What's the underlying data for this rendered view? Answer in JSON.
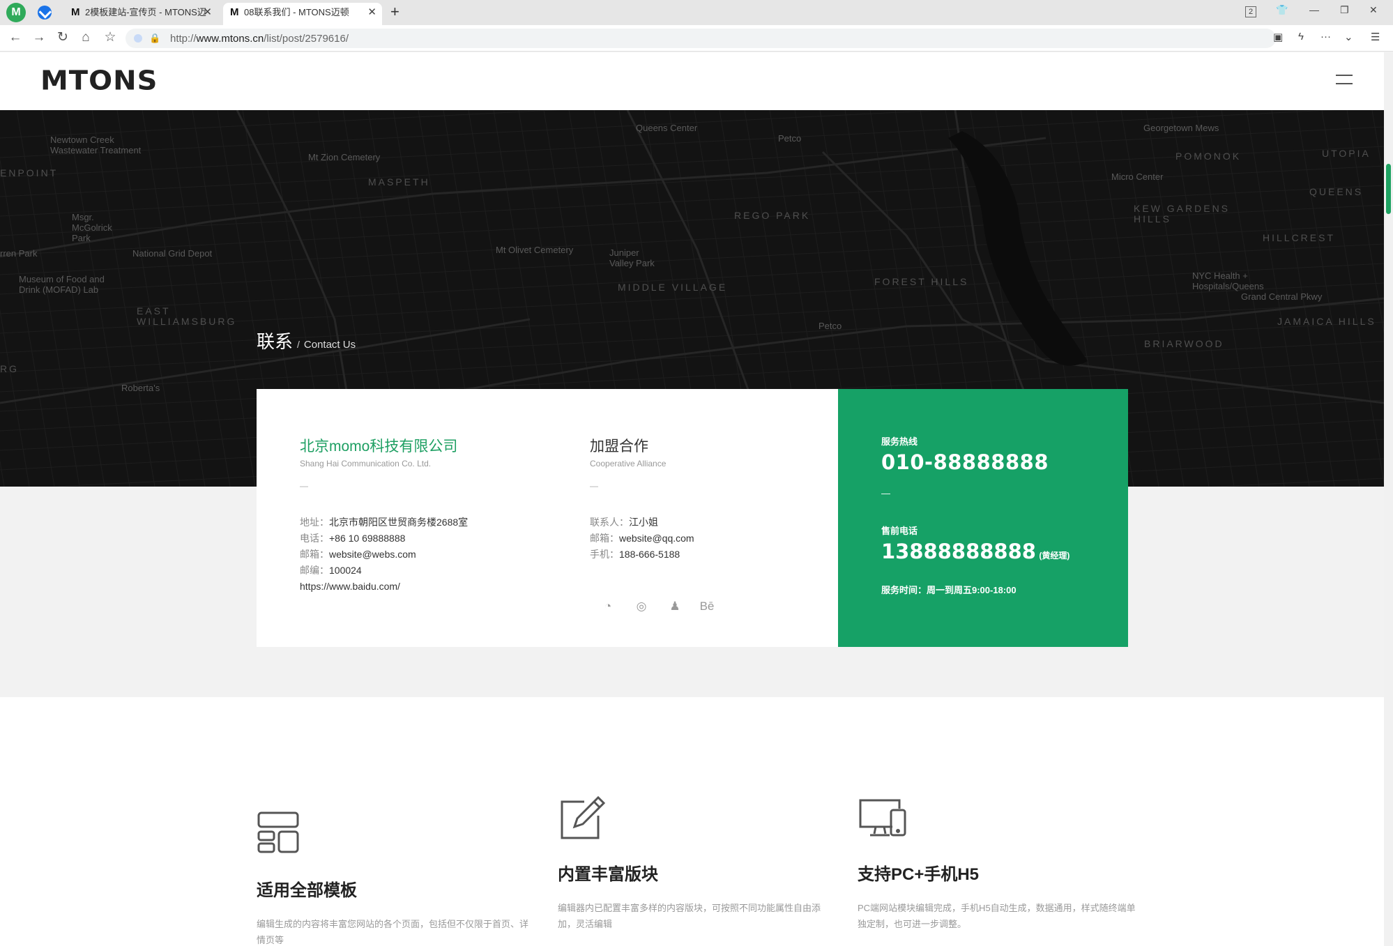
{
  "browser": {
    "tabs": [
      {
        "favicon": "M",
        "title": "2模板建站-宣传页 - MTONS迈",
        "close": "✕",
        "active": false
      },
      {
        "favicon": "M",
        "title": "08联系我们 - MTONS迈顿",
        "close": "✕",
        "active": true
      }
    ],
    "new_tab": "+",
    "tab_count": "2",
    "url_scheme": "http://",
    "url_domain": "www.mtons.cn",
    "url_path": "/list/post/2579616/",
    "icons": [
      "back-icon",
      "forward-icon",
      "reload-icon",
      "home-icon",
      "favorites-icon",
      "security-icon",
      "screenshot-icon",
      "lightning-icon",
      "more-icon",
      "dropdown-icon",
      "menu-icon"
    ]
  },
  "site": {
    "logo": "MTONS",
    "banner": {
      "title_cn": "联系",
      "separator": "/",
      "title_en": "Contact Us"
    },
    "map_places": [
      {
        "text": "Newtown Creek\nWastewater Treatment",
        "cls": ""
      },
      {
        "text": "ENPOINT",
        "cls": "big"
      },
      {
        "text": "Msgr.\nMcGolrick\nPark",
        "cls": ""
      },
      {
        "text": "rren Park",
        "cls": ""
      },
      {
        "text": "Museum of Food and\nDrink (MOFAD) Lab",
        "cls": ""
      },
      {
        "text": "EAST\nWILLIAMSBURG",
        "cls": "big"
      },
      {
        "text": "Mt Zion Cemetery",
        "cls": ""
      },
      {
        "text": "MASPETH",
        "cls": "big"
      },
      {
        "text": "National Grid Depot",
        "cls": ""
      },
      {
        "text": "Queens Center",
        "cls": ""
      },
      {
        "text": "Petco",
        "cls": ""
      },
      {
        "text": "REGO PARK",
        "cls": "big"
      },
      {
        "text": "Mt Olivet Cemetery",
        "cls": ""
      },
      {
        "text": "Juniper\nValley Park",
        "cls": ""
      },
      {
        "text": "MIDDLE VILLAGE",
        "cls": "big"
      },
      {
        "text": "Petco",
        "cls": ""
      },
      {
        "text": "FOREST HILLS",
        "cls": "big"
      },
      {
        "text": "Georgetown Mews",
        "cls": ""
      },
      {
        "text": "POMONOK",
        "cls": "big"
      },
      {
        "text": "Micro Center",
        "cls": ""
      },
      {
        "text": "KEW GARDENS\nHILLS",
        "cls": "big"
      },
      {
        "text": "QUEENS",
        "cls": "big"
      },
      {
        "text": "UTOPIA",
        "cls": "big"
      },
      {
        "text": "HILLCREST",
        "cls": "big"
      },
      {
        "text": "NYC Health +\nHospitals/Queens",
        "cls": ""
      },
      {
        "text": "Grand Central Pkwy",
        "cls": ""
      },
      {
        "text": "JAMAICA HILLS",
        "cls": "big"
      },
      {
        "text": "BRIARWOOD",
        "cls": "big"
      },
      {
        "text": "Roberta's",
        "cls": ""
      },
      {
        "text": "RG",
        "cls": "big"
      }
    ]
  },
  "contact": {
    "company": {
      "name": "北京momo科技有限公司",
      "sub": "Shang Hai  Communication Co. Ltd.",
      "dash": "—",
      "lines": [
        {
          "k": "地址：",
          "v": "北京市朝阳区世贸商务楼2688室"
        },
        {
          "k": "电话：",
          "v": "+86 10 69888888"
        },
        {
          "k": "邮箱：",
          "v": "website@webs.com"
        },
        {
          "k": "邮编：",
          "v": "100024"
        },
        {
          "k": "",
          "v": "https://www.baidu.com/"
        }
      ]
    },
    "alliance": {
      "title": "加盟合作",
      "sub": "Cooperative Alliance",
      "dash": "—",
      "lines": [
        {
          "k": "联系人：",
          "v": "江小姐"
        },
        {
          "k": "邮箱：",
          "v": "website@qq.com"
        },
        {
          "k": "手机：",
          "v": "188-666-5188"
        }
      ],
      "social": [
        {
          "name": "weibo-icon",
          "glyph": "◔"
        },
        {
          "name": "wechat-icon",
          "glyph": "◎"
        },
        {
          "name": "qq-icon",
          "glyph": "♟"
        },
        {
          "name": "behance-icon",
          "glyph": "Bē"
        }
      ]
    },
    "service": {
      "hotline_label": "服务热线",
      "hotline": "010-88888888",
      "dash": "—",
      "presale_label": "售前电话",
      "presale": "13888888888",
      "presale_manager": "(黄经理)",
      "hours": "服务时间：周一到周五9:00-18:00",
      "color": "#16a166"
    }
  },
  "features": [
    {
      "icon": "layout-template-icon",
      "title": "适用全部模板",
      "desc": "编辑生成的内容将丰富您网站的各个页面，包括但不仅限于首页、详情页等"
    },
    {
      "icon": "edit-pencil-icon",
      "title": "内置丰富版块",
      "desc": "编辑器内已配置丰富多样的内容版块，可按照不同功能属性自由添加，灵活编辑"
    },
    {
      "icon": "pc-mobile-icon",
      "title": "支持PC+手机H5",
      "desc": "PC端网站模块编辑完成，手机H5自动生成，数据通用，样式随终端单独定制，也可进一步调整。"
    }
  ],
  "colors": {
    "accent": "#16a166",
    "banner_bg": "#131313"
  }
}
